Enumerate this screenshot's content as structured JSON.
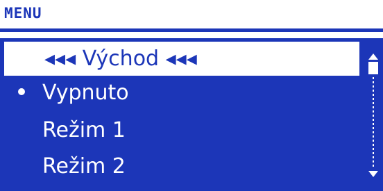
{
  "header": {
    "title": "MENU"
  },
  "menu": {
    "items": [
      {
        "label": "◂◂◂ Východ ◂◂◂",
        "selected": true
      },
      {
        "label": "Vypnuto",
        "active": true
      },
      {
        "label": "Režim 1"
      },
      {
        "label": "Režim 2"
      }
    ]
  },
  "colors": {
    "accent": "#1c36b8",
    "text_on_accent": "#ffffff",
    "background": "#ffffff"
  },
  "icons": {
    "active_marker": "bullet-icon",
    "scroll_up": "scroll-up-arrow-icon",
    "scroll_down": "scroll-down-arrow-icon"
  }
}
